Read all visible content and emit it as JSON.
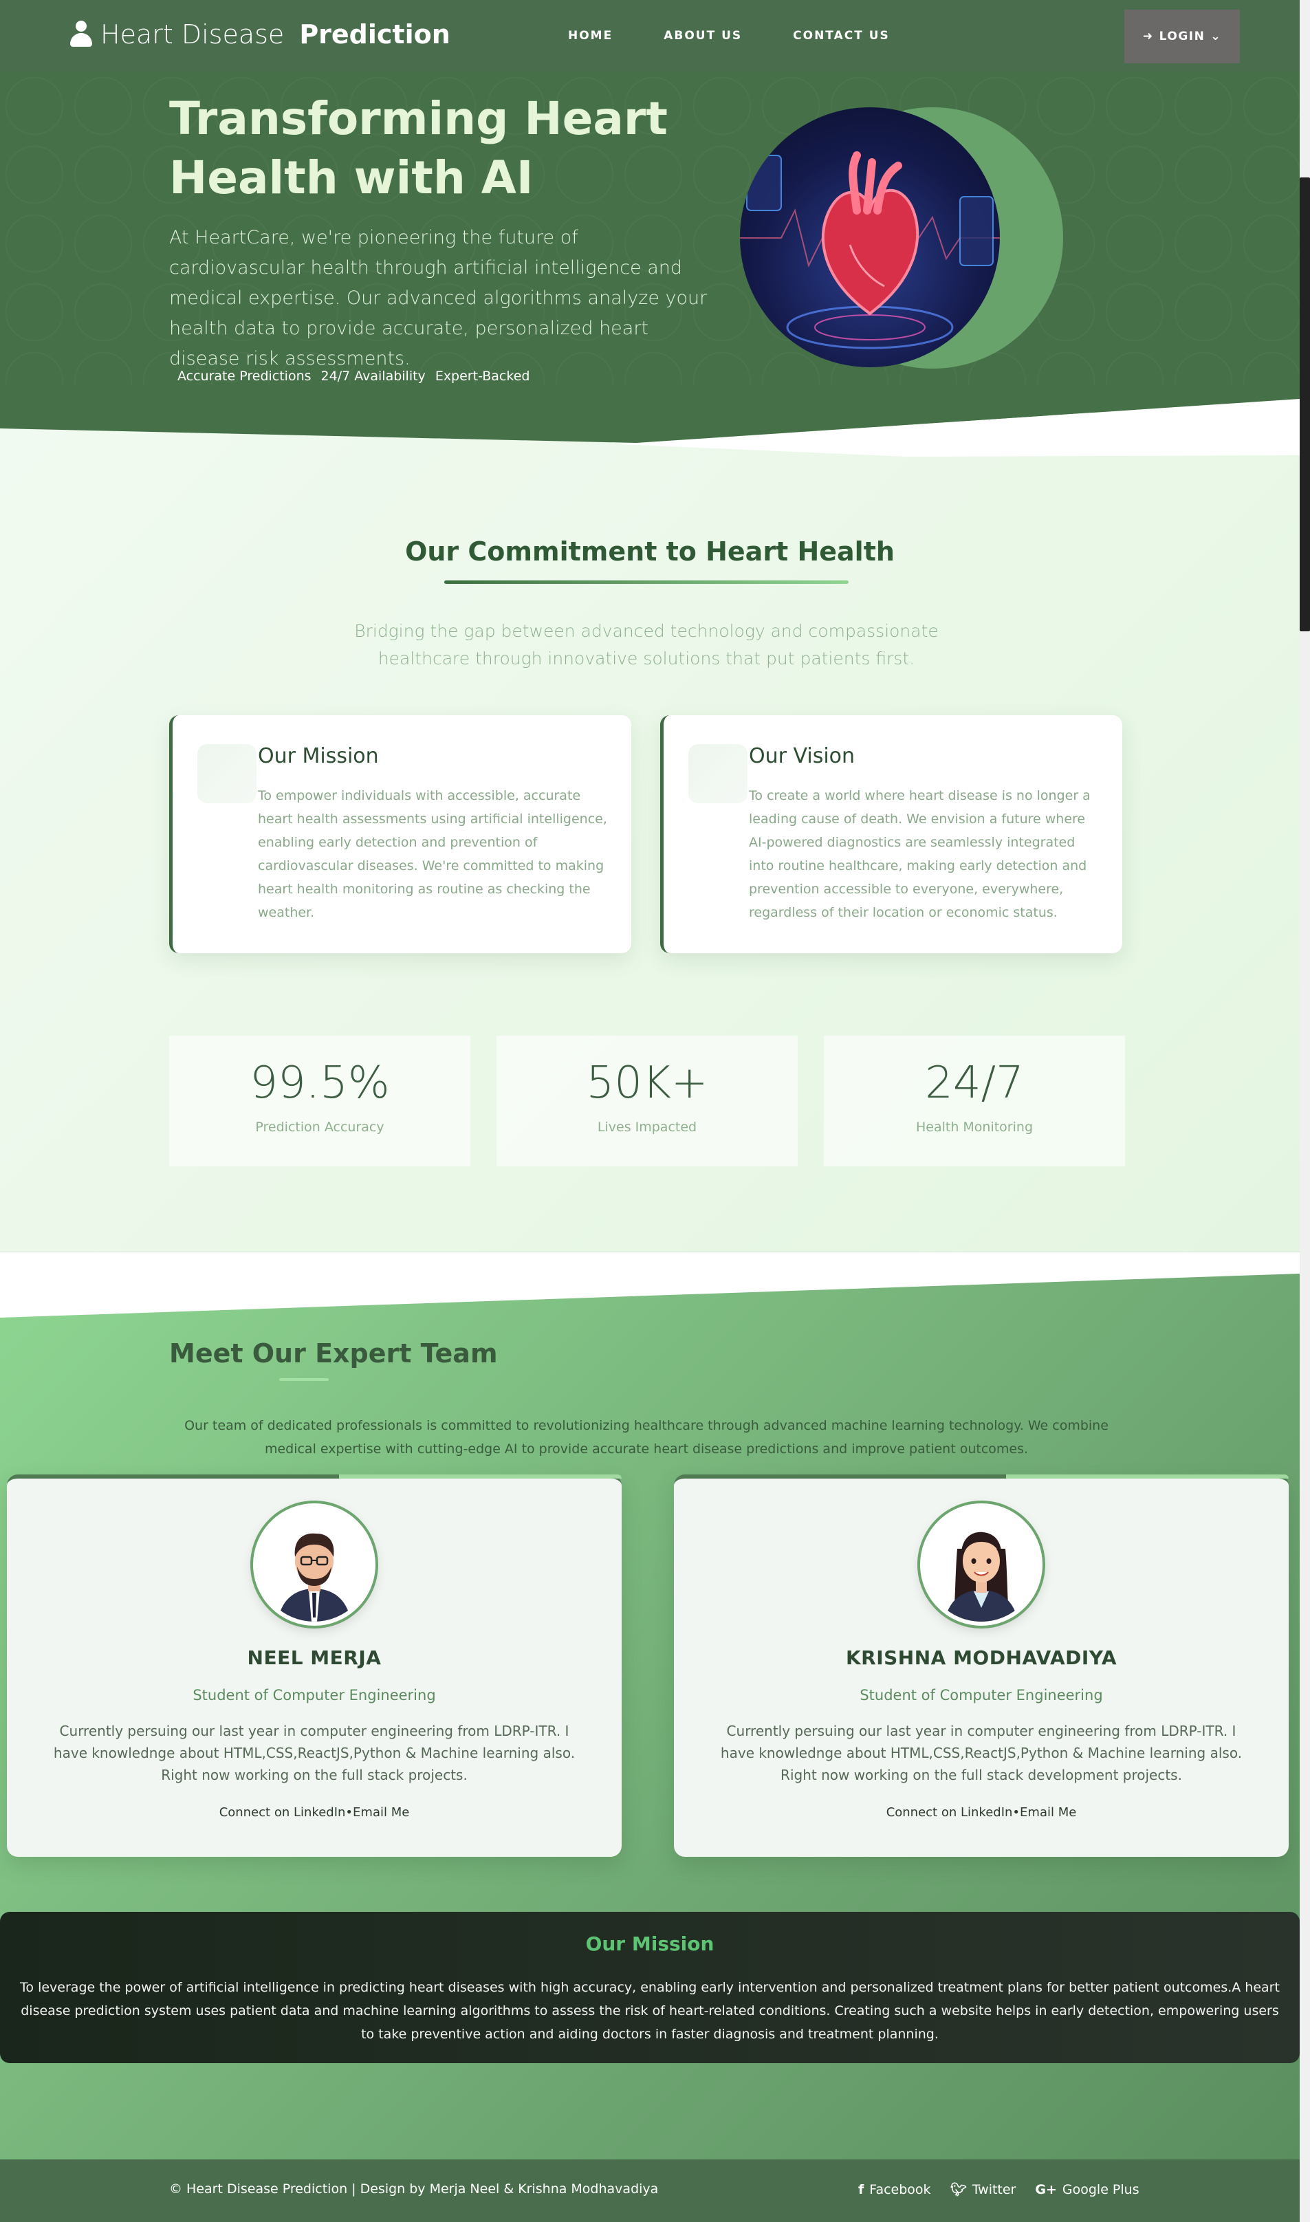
{
  "nav": {
    "brand_light": "Heart Disease",
    "brand_bold": "Prediction",
    "links": [
      "HOME",
      "ABOUT US",
      "CONTACT US"
    ],
    "login": "LOGIN"
  },
  "hero": {
    "title": "Transforming Heart Health with AI",
    "text": "At HeartCare, we're pioneering the future of cardiovascular health through artificial intelligence and medical expertise. Our advanced algorithms analyze your health data to provide accurate, personalized heart disease risk assessments.",
    "tags": [
      "Accurate Predictions",
      "24/7 Availability",
      "Expert-Backed"
    ]
  },
  "commitment": {
    "title": "Our Commitment to Heart Health",
    "subtitle": "Bridging the gap between advanced technology and compassionate healthcare through innovative solutions that put patients first.",
    "cards": [
      {
        "title": "Our Mission",
        "text": "To empower individuals with accessible, accurate heart health assessments using artificial intelligence, enabling early detection and prevention of cardiovascular diseases. We're committed to making heart health monitoring as routine as checking the weather."
      },
      {
        "title": "Our Vision",
        "text": "To create a world where heart disease is no longer a leading cause of death. We envision a future where AI-powered diagnostics are seamlessly integrated into routine healthcare, making early detection and prevention accessible to everyone, everywhere, regardless of their location or economic status."
      }
    ],
    "stats": [
      {
        "value": "99.5%",
        "label": "Prediction Accuracy"
      },
      {
        "value": "50K+",
        "label": "Lives Impacted"
      },
      {
        "value": "24/7",
        "label": "Health Monitoring"
      }
    ]
  },
  "team": {
    "title": "Meet Our Expert Team",
    "subtitle": "Our team of dedicated professionals is committed to revolutionizing healthcare through advanced machine learning technology. We combine medical expertise with cutting-edge AI to provide accurate heart disease predictions and improve patient outcomes.",
    "members": [
      {
        "name": "NEEL MERJA",
        "role": "Student of Computer Engineering",
        "desc": "Currently persuing our last year in computer engineering from LDRP-ITR. I have knowlednge about HTML,CSS,ReactJS,Python & Machine learning also. Right now working on the full stack projects.",
        "links": "Connect on LinkedIn•Email Me"
      },
      {
        "name": "KRISHNA MODHAVADIYA",
        "role": "Student of Computer Engineering",
        "desc": "Currently persuing our last year in computer engineering from LDRP-ITR. I have knowlednge about HTML,CSS,ReactJS,Python & Machine learning also. Right now working on the full stack development projects.",
        "links": "Connect on LinkedIn•Email Me"
      }
    ]
  },
  "mission": {
    "title": "Our Mission",
    "text": "To leverage the power of artificial intelligence in predicting heart diseases with high accuracy, enabling early intervention and personalized treatment plans for better patient outcomes.A heart disease prediction system uses patient data and machine learning algorithms to assess the risk of heart-related conditions. Creating such a website helps in early detection, empowering users to take preventive action and aiding doctors in faster diagnosis and treatment planning."
  },
  "footer": {
    "copyright": "© Heart Disease Prediction | Design by Merja Neel & Krishna Modhavadiya",
    "social": [
      "Facebook",
      "Twitter",
      "Google Plus"
    ]
  }
}
